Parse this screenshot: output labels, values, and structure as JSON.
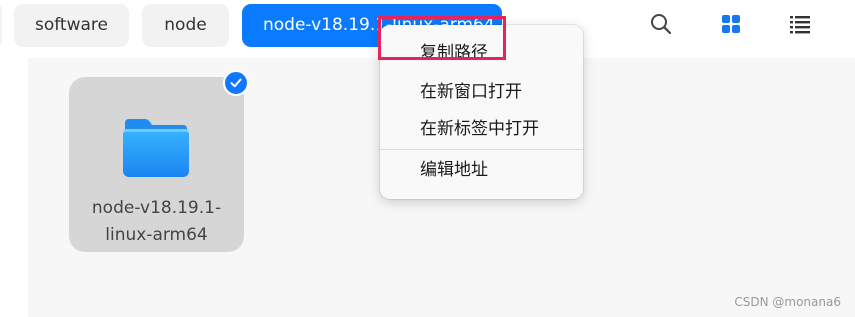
{
  "breadcrumbs": [
    {
      "label": ""
    },
    {
      "label": "software"
    },
    {
      "label": "node"
    },
    {
      "label": "node-v18.19.1-linux-arm64"
    }
  ],
  "toolbar": {
    "search_icon": "search-icon",
    "grid_view_icon": "grid-view-icon",
    "list_view_icon": "list-view-icon",
    "accent": "#0a7aff"
  },
  "file": {
    "name_line1": "node-v18.19.1-",
    "name_line2": "linux-arm64",
    "icon": "folder-icon",
    "selected": true
  },
  "context_menu": {
    "items": [
      {
        "label": "复制路径"
      },
      {
        "label": "在新窗口打开"
      },
      {
        "label": "在新标签中打开"
      },
      {
        "label": "编辑地址"
      }
    ],
    "highlight_color": "#e8225a"
  },
  "watermark": "CSDN @monana6"
}
